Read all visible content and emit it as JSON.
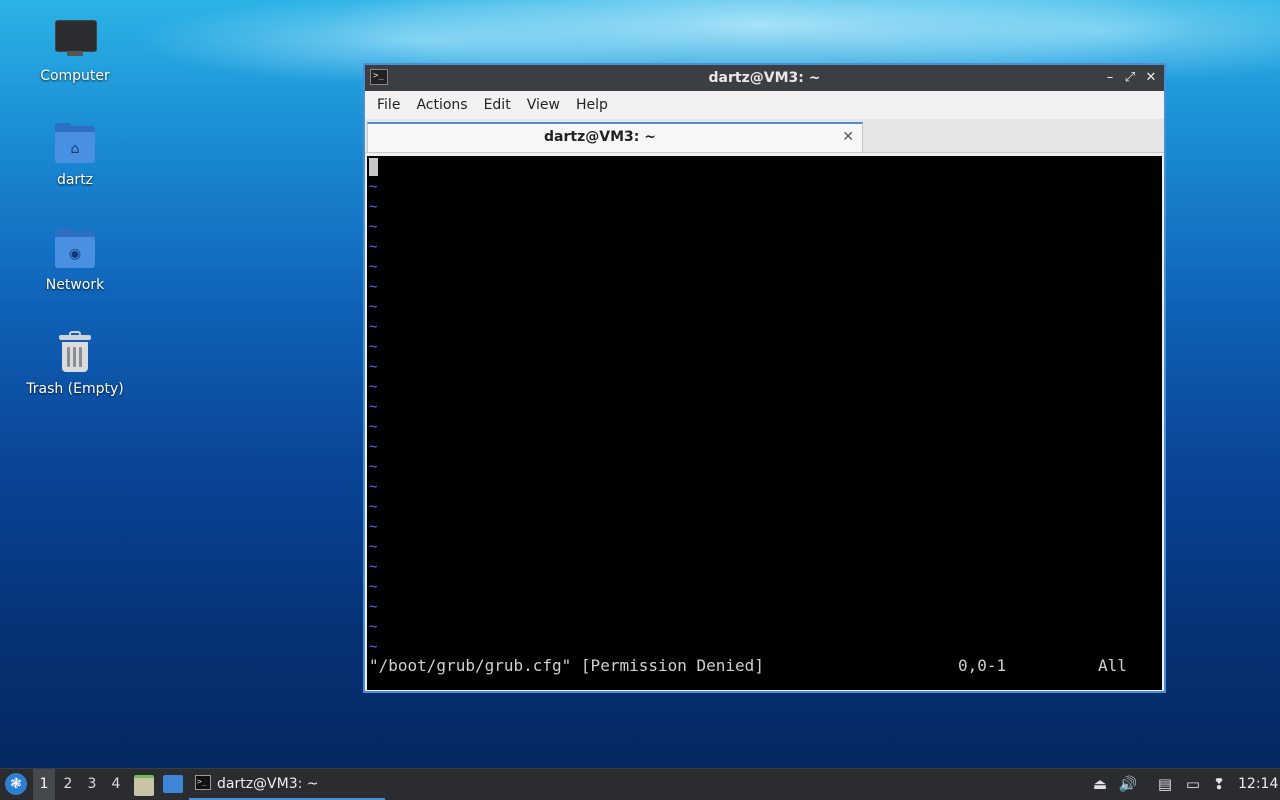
{
  "desktop": {
    "icons": [
      {
        "label": "Computer",
        "icon": "computer-icon"
      },
      {
        "label": "dartz",
        "icon": "home-folder-icon"
      },
      {
        "label": "Network",
        "icon": "network-folder-icon"
      },
      {
        "label": "Trash (Empty)",
        "icon": "trash-icon"
      }
    ]
  },
  "window": {
    "title": "dartz@VM3: ~",
    "menu": [
      "File",
      "Actions",
      "Edit",
      "View",
      "Help"
    ],
    "tab_title": "dartz@VM3: ~",
    "accent": "#4a8fd6"
  },
  "terminal": {
    "tilde": "~",
    "status_line": "\"/boot/grub/grub.cfg\" [Permission Denied]",
    "cursor_pos": "0,0-1",
    "scroll_pos": "All",
    "tilde_color": "#4e6bff"
  },
  "taskbar": {
    "workspaces": [
      "1",
      "2",
      "3",
      "4"
    ],
    "active_workspace": "1",
    "task_label": "dartz@VM3: ~",
    "clock": "12:14"
  }
}
